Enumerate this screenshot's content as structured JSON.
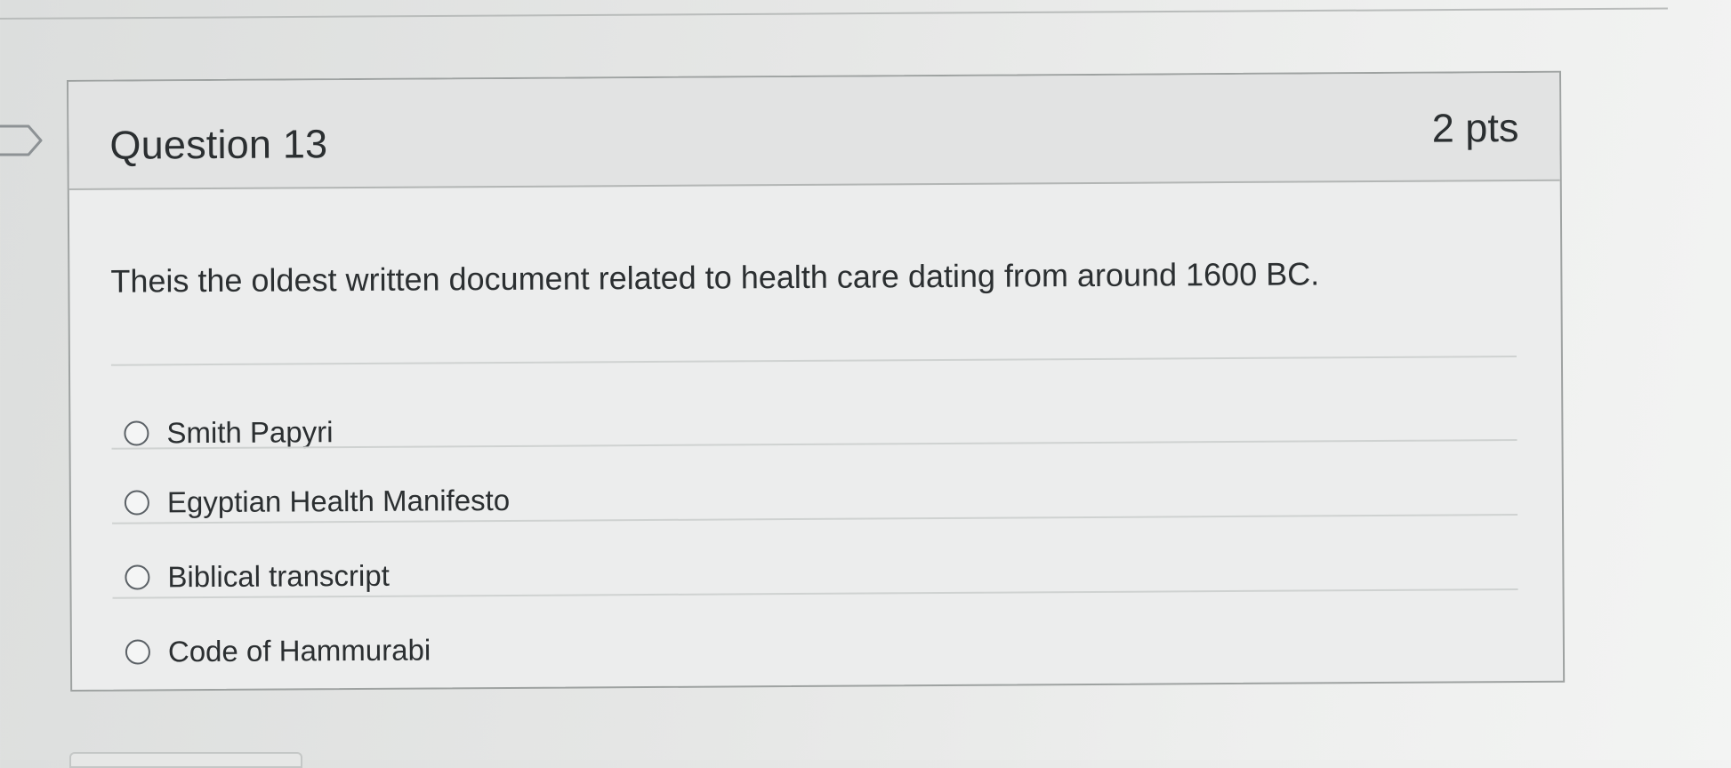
{
  "question": {
    "title": "Question 13",
    "points": "2 pts",
    "text": "Theis the oldest written document related to health care dating from around 1600 BC.",
    "answers": [
      {
        "label": "Smith Papyri",
        "selected": false
      },
      {
        "label": "Egyptian Health Manifesto",
        "selected": false
      },
      {
        "label": "Biblical transcript",
        "selected": false
      },
      {
        "label": "Code of Hammurabi",
        "selected": false
      }
    ]
  },
  "icons": {
    "flag": "flag-outline-icon",
    "radio": "radio-unchecked-icon"
  },
  "colors": {
    "card_header_bg": "#e2e3e3",
    "card_border": "#9ea2a1",
    "text": "#2b2f31"
  }
}
